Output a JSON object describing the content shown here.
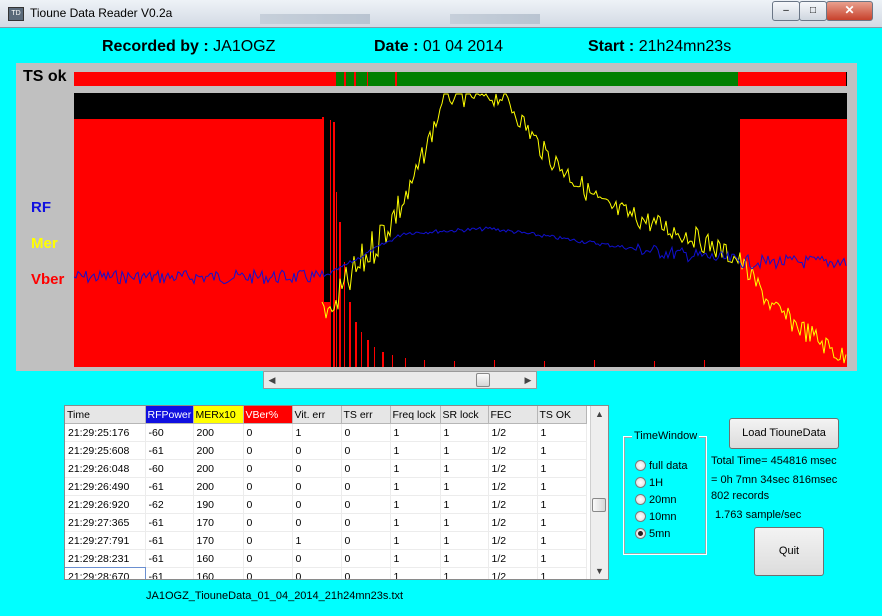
{
  "window": {
    "title": "Tioune Data Reader V0.2a",
    "minimize": "‒",
    "maximize": "□",
    "close": "✕"
  },
  "header": {
    "recorded_label": "Recorded by :",
    "recorded_value": "JA1OGZ",
    "date_label": "Date :",
    "date_value": "01 04 2014",
    "start_label": "Start :",
    "start_value": "21h24mn23s"
  },
  "plot": {
    "ts_label": "TS ok",
    "rf_label": "RF",
    "mer_label": "Mer",
    "vber_label": "Vber",
    "colors": {
      "ts_ok": "#008000",
      "ts_err": "#ff0000",
      "rf": "#1010d0",
      "mer": "#ffff00",
      "vber": "#ff0000",
      "background": "#000000"
    },
    "scrollbar_position": 0.86
  },
  "table": {
    "columns": [
      {
        "label": "Time",
        "bg": ""
      },
      {
        "label": "RFPower",
        "bg": "#1010e0",
        "fg": "#ffffff"
      },
      {
        "label": "MERx10",
        "bg": "#ffff00",
        "fg": "#000000"
      },
      {
        "label": "VBer%",
        "bg": "#ff0000",
        "fg": "#ffffff"
      },
      {
        "label": "Vit. err",
        "bg": ""
      },
      {
        "label": "TS err",
        "bg": ""
      },
      {
        "label": "Freq lock",
        "bg": ""
      },
      {
        "label": "SR lock",
        "bg": ""
      },
      {
        "label": "FEC",
        "bg": ""
      },
      {
        "label": "TS OK",
        "bg": ""
      }
    ],
    "rows": [
      [
        "21:29:25:176",
        "-60",
        "200",
        "0",
        "1",
        "0",
        "1",
        "1",
        "1/2",
        "1"
      ],
      [
        "21:29:25:608",
        "-61",
        "200",
        "0",
        "0",
        "0",
        "1",
        "1",
        "1/2",
        "1"
      ],
      [
        "21:29:26:048",
        "-60",
        "200",
        "0",
        "0",
        "0",
        "1",
        "1",
        "1/2",
        "1"
      ],
      [
        "21:29:26:490",
        "-61",
        "200",
        "0",
        "0",
        "0",
        "1",
        "1",
        "1/2",
        "1"
      ],
      [
        "21:29:26:920",
        "-62",
        "190",
        "0",
        "0",
        "0",
        "1",
        "1",
        "1/2",
        "1"
      ],
      [
        "21:29:27:365",
        "-61",
        "170",
        "0",
        "0",
        "0",
        "1",
        "1",
        "1/2",
        "1"
      ],
      [
        "21:29:27:791",
        "-61",
        "170",
        "0",
        "1",
        "0",
        "1",
        "1",
        "1/2",
        "1"
      ],
      [
        "21:29:28:231",
        "-61",
        "160",
        "0",
        "0",
        "0",
        "1",
        "1",
        "1/2",
        "1"
      ],
      [
        "21:29:28:670",
        "-61",
        "160",
        "0",
        "0",
        "0",
        "1",
        "1",
        "1/2",
        "1"
      ]
    ],
    "scroll_position": 0.6
  },
  "filename": "JA1OGZ_TiouneData_01_04_2014_21h24mn23s.txt",
  "time_window": {
    "legend": "TimeWindow",
    "options": [
      "full data",
      "1H",
      "20mn",
      "10mn",
      "5mn"
    ],
    "selected": "5mn"
  },
  "buttons": {
    "load": "Load TiouneData",
    "quit": "Quit"
  },
  "info": {
    "total_time": "Total Time= 454816 msec",
    "duration": "= 0h 7mn 34sec 816msec",
    "records": "802 records",
    "rate": "1.763 sample/sec"
  }
}
